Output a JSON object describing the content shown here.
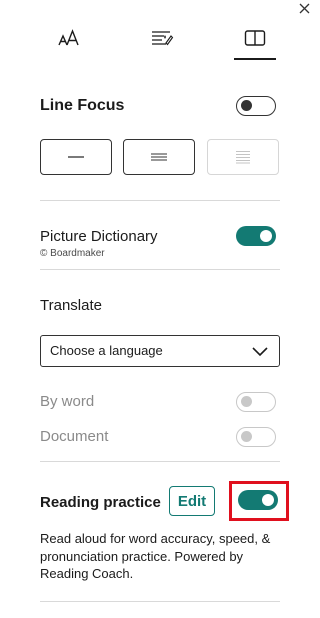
{
  "tabs": {
    "text_size_icon": "text-size-icon",
    "text_preferences_icon": "text-preferences-icon",
    "reading_preferences_icon": "reading-preferences-icon",
    "active": "reading-preferences"
  },
  "line_focus": {
    "label": "Line Focus",
    "enabled": false,
    "options": [
      "one-line",
      "three-lines",
      "five-lines"
    ]
  },
  "picture_dictionary": {
    "label": "Picture Dictionary",
    "credit": "© Boardmaker",
    "enabled": true
  },
  "translate": {
    "label": "Translate",
    "select_value": "Choose a language",
    "by_word_label": "By word",
    "by_word_enabled": false,
    "document_label": "Document",
    "document_enabled": false
  },
  "reading_practice": {
    "label": "Reading practice",
    "edit_label": "Edit",
    "enabled": true,
    "description": "Read aloud for word accuracy, speed, & pronunciation practice. Powered by Reading Coach."
  },
  "colors": {
    "accent": "#137a73",
    "highlight": "#e0101e"
  }
}
